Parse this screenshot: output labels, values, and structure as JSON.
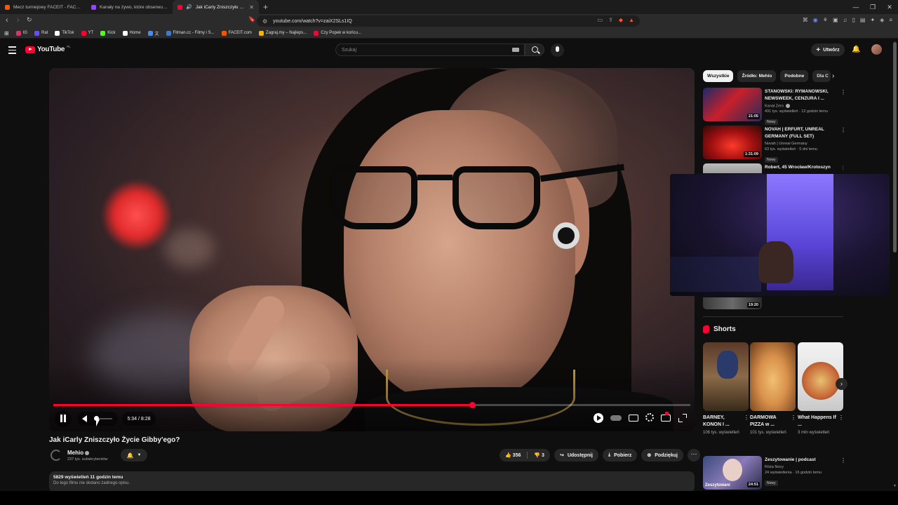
{
  "browser": {
    "tabs": [
      {
        "label": "Mecz turniejowy FACEIT - FACEIT.com",
        "color": "#ff5500",
        "active": false
      },
      {
        "label": "Kanały na żywo, które obserwujesz -",
        "color": "#9146ff",
        "active": false
      },
      {
        "label": "Jak iCarly Zniszczyło Życie Gib",
        "color": "#ff0033",
        "active": true
      }
    ],
    "url": "youtube.com/watch?v=zaiX2SLs1IQ",
    "bookmarks": [
      {
        "label": "IG",
        "color": "#e1306c"
      },
      {
        "label": "Rat",
        "color": "#6a4cff"
      },
      {
        "label": "TikTok",
        "color": "#ffffff"
      },
      {
        "label": "YT",
        "color": "#ff0033"
      },
      {
        "label": "Kick",
        "color": "#53fc18"
      },
      {
        "label": "Home",
        "color": "#ffffff"
      },
      {
        "label": "文",
        "color": "#4a8af4"
      },
      {
        "label": "Filman.cc - Filmy i S...",
        "color": "#3a7bd5"
      },
      {
        "label": "FACEIT.com",
        "color": "#ff5500"
      },
      {
        "label": "Zagraj.my – Najleps...",
        "color": "#f4b400"
      },
      {
        "label": "Czy Popek w końcu...",
        "color": "#ff0033"
      }
    ]
  },
  "header": {
    "logo_text": "YouTube",
    "region": "PL",
    "search_placeholder": "Szukaj",
    "create_label": "Utwórz"
  },
  "player": {
    "time": "5:34 / 8:28",
    "progress": 0.657
  },
  "video": {
    "title": "Jak iCarly Zniszczyło Życie Gibby'ego?",
    "channel": "Mehio",
    "subscribers": "237 tys. subskrybentów",
    "likes": "356",
    "dislikes": "3",
    "share": "Udostępnij",
    "download": "Pobierz",
    "thanks": "Podziękuj",
    "views_time": "5829 wyświetleń  11 godzin temu",
    "description": "Do tego filmu nie dodano żadnego opisu."
  },
  "sidebar": {
    "chips": [
      "Wszystkie",
      "Źródło: Mehio",
      "Podobne",
      "Dla C"
    ],
    "recommendations": [
      {
        "title": "STANOWSKI: RYMANOWSKI, NEWSWEEK, CENZURA I ...",
        "channel": "Kanał Zero",
        "stats": "431 tys. wyświetleń · 12 godzin temu",
        "badge": "Nowy",
        "duration": "21:05"
      },
      {
        "title": "NOVAH | ERFURT, UNREAL GERMANY (FULL SET)",
        "channel": "Novah | Unreal Germany",
        "stats": "63 tys. wyświetleń · 5 dni temu",
        "badge": "Nowy",
        "duration": "1:31:09"
      },
      {
        "title": "Robert, 45 Wrocław/Krotoszyn",
        "channel": "",
        "stats": "",
        "badge": "",
        "duration": ""
      }
    ],
    "hidden_duration": "19:20",
    "shorts_heading": "Shorts",
    "shorts": [
      {
        "title": "BARNEY, KONON I ...",
        "views": "106 tys. wyświetleń"
      },
      {
        "title": "DARMOWA PIZZA w ...",
        "views": "101 tys. wyświetleń"
      },
      {
        "title": "What Happens If ...",
        "views": "3 mln wyświetleń"
      }
    ],
    "bottom_rec": {
      "title": "Zeszytowanie | podcast",
      "channel": "Róża Nocy",
      "stats": "24 wyświetlenia · 16 godzin temu",
      "badge": "Nowy",
      "duration": "24:51",
      "thumb_text": "Zeszytowani"
    }
  }
}
